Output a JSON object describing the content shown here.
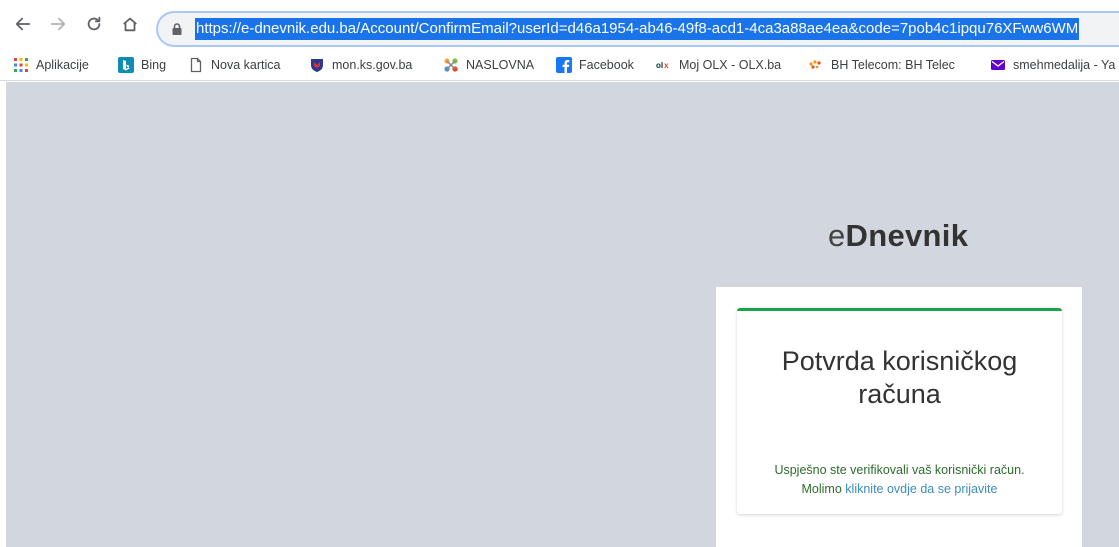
{
  "browser": {
    "url": "https://e-dnevnik.edu.ba/Account/ConfirmEmail?userId=d46a1954-ab46-49f8-acd1-4ca3a88ae4ea&code=7pob4c1ipqu76XFww6WM"
  },
  "bookmarks": [
    {
      "label": "Aplikacije",
      "icon": "apps-grid-icon"
    },
    {
      "label": "Bing",
      "icon": "bing-icon"
    },
    {
      "label": "Nova kartica",
      "icon": "page-icon"
    },
    {
      "label": "mon.ks.gov.ba",
      "icon": "crest-icon"
    },
    {
      "label": "NASLOVNA",
      "icon": "joomla-icon"
    },
    {
      "label": "Facebook",
      "icon": "facebook-icon"
    },
    {
      "label": "Moj OLX - OLX.ba",
      "icon": "olx-icon"
    },
    {
      "label": "BH Telecom: BH Telec",
      "icon": "bh-telecom-icon"
    },
    {
      "label": "smehmedalija - Ya",
      "icon": "mail-icon"
    }
  ],
  "logo": {
    "prefix": "e",
    "name": "Dnevnik"
  },
  "card": {
    "title": "Potvrda korisničkog računa",
    "message": "Uspješno ste verifikovali vaš korisnički račun.",
    "prompt": "Molimo",
    "link": "kliknite ovdje da se prijavite"
  },
  "colors": {
    "card_accent": "#16a34a",
    "page_background": "#d2d6de",
    "link": "#3c8dbc",
    "url_highlight": "#1a73e8"
  }
}
